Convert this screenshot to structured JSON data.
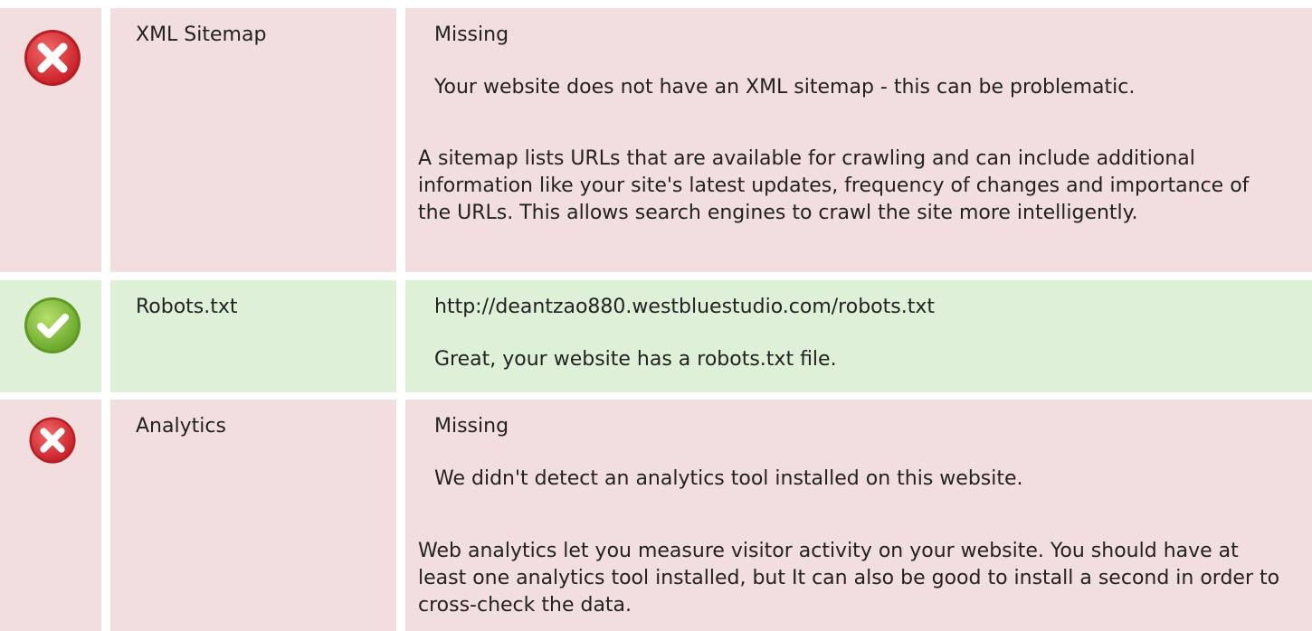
{
  "checks": [
    {
      "status": "fail",
      "icon": "error-x-icon",
      "label": "XML Sitemap",
      "value": "Missing",
      "message": "Your website does not have an XML sitemap - this can be problematic.",
      "description": "A sitemap lists URLs that are available for crawling and can include additional information like your site's latest updates, frequency of changes and importance of the URLs. This allows search engines to crawl the site more intelligently."
    },
    {
      "status": "pass",
      "icon": "success-check-icon",
      "label": "Robots.txt",
      "value": "http://deantzao880.westbluestudio.com/robots.txt",
      "message": "Great, your website has a robots.txt file."
    },
    {
      "status": "fail",
      "icon": "error-x-icon",
      "label": "Analytics",
      "value": "Missing",
      "message": "We didn't detect an analytics tool installed on this website.",
      "description": "Web analytics let you measure visitor activity on your website. You should have at least one analytics tool installed, but It can also be good to install a second in order to cross-check the data."
    }
  ],
  "colors": {
    "fail_background": "#f2dede",
    "pass_background": "#dff0d8",
    "fail_icon": "#e0383a",
    "pass_icon": "#8cc63f"
  }
}
